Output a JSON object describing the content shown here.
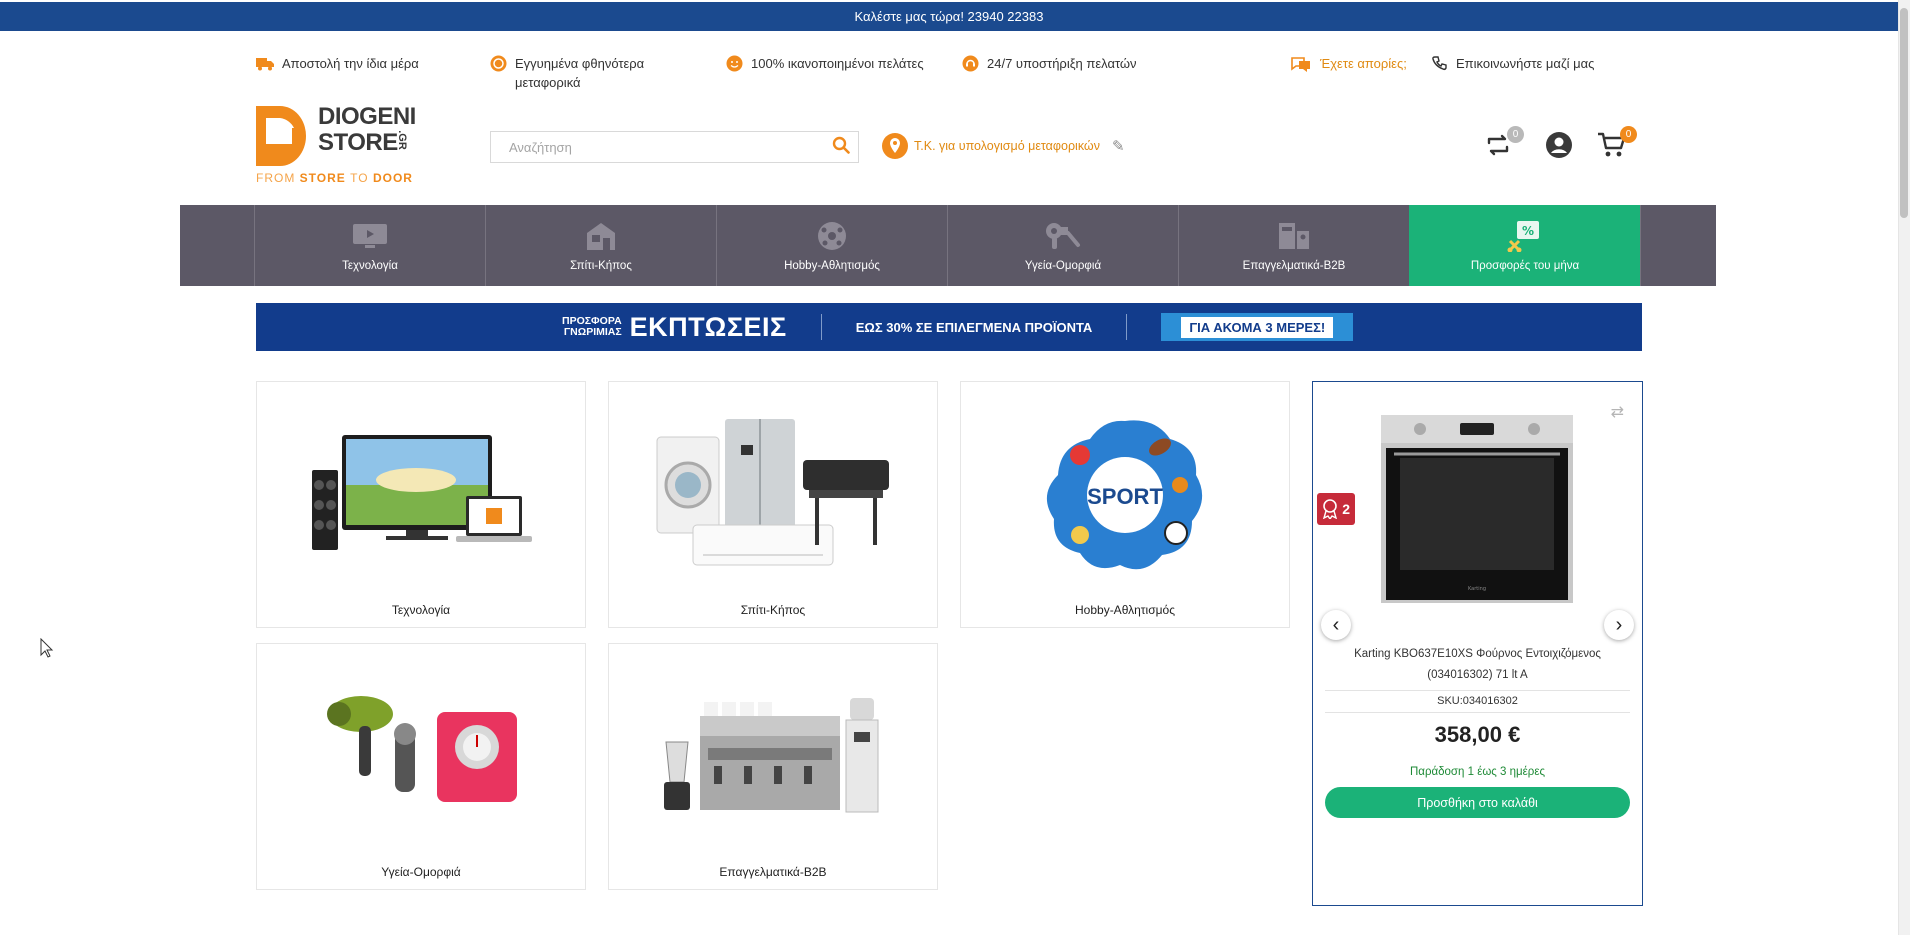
{
  "topbar": {
    "text": "Καλέστε μας τώρα! 23940 22383"
  },
  "info": {
    "items": [
      {
        "label": "Αποστολή την ίδια μέρα",
        "icon": "truck-icon"
      },
      {
        "label": "Εγγυημένα φθηνότερα μεταφορικά",
        "icon": "coin-icon"
      },
      {
        "label": "100% ικανοποιημένοι πελάτες",
        "icon": "smile-icon"
      },
      {
        "label": "24/7 υποστήριξη πελατών",
        "icon": "support-icon"
      }
    ],
    "questions": "Έχετε απορίες;",
    "contact": "Επικοινωνήστε μαζί μας"
  },
  "logo": {
    "line1": "DIOGENI",
    "line2": "STORE",
    "suffix": ".GR",
    "tag_from": "FROM",
    "tag_store": "STORE",
    "tag_to": "TO",
    "tag_door": "DOOR"
  },
  "search": {
    "placeholder": "Αναζήτηση"
  },
  "zip": {
    "label": "Τ.Κ. για υπολογισμό μεταφορικών"
  },
  "header": {
    "compare_count": "0",
    "cart_count": "0"
  },
  "nav": {
    "categories": [
      {
        "label": "Τεχνολογία"
      },
      {
        "label": "Σπίτι-Κήπος"
      },
      {
        "label": "Hobby-Αθλητισμός"
      },
      {
        "label": "Υγεία-Ομορφιά"
      },
      {
        "label": "Επαγγελματικά-B2B"
      },
      {
        "label": "Προσφορές του μήνα"
      }
    ]
  },
  "promo": {
    "line1": "ΠΡΟΣΦΟΡΑ",
    "line2": "ΓΝΩΡΙΜΙΑΣ",
    "title": "ΕΚΠΤΩΣΕΙΣ",
    "subtitle": "ΕΩΣ 30% ΣΕ ΕΠΙΛΕΓΜΕΝΑ ΠΡΟΪΟΝΤΑ",
    "ribbon": "ΓΙΑ ΑΚΟΜΑ 3 ΜΕΡΕΣ!"
  },
  "tiles": [
    {
      "label": "Τεχνολογία"
    },
    {
      "label": "Σπίτι-Κήπος"
    },
    {
      "label": "Hobby-Αθλητισμός",
      "art_text": "SPORT"
    },
    {
      "label": "Υγεία-Ομορφιά"
    },
    {
      "label": "Επαγγελματικά-B2B"
    }
  ],
  "product": {
    "reward_count": "2",
    "name": "Karting KBO637E10XS Φούρνος Εντοιχιζόμενος (034016302) 71 lt A",
    "sku": "SKU:034016302",
    "price": "358,00 €",
    "delivery": "Παράδοση 1 έως 3 ημέρες",
    "cart_button": "Προσθήκη στο καλάθι",
    "oven_brand": "Karting"
  },
  "colors": {
    "blue": "#1b4a8f",
    "orange": "#f08a1c",
    "green": "#1bb278",
    "nav": "#5c5866",
    "red_badge": "#c62b3a"
  }
}
